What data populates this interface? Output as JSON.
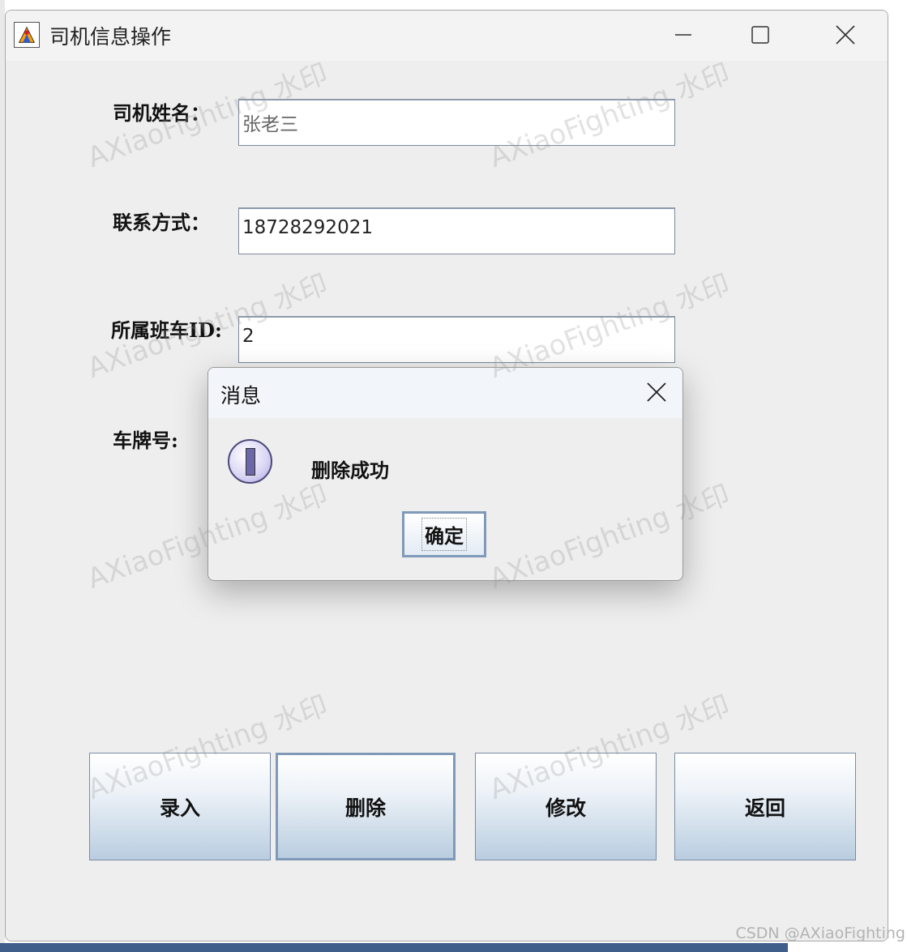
{
  "window": {
    "title": "司机信息操作"
  },
  "form": {
    "driver_name_label": "司机姓名：",
    "driver_name_value": "张老三",
    "contact_label": "联系方式：",
    "contact_value": "18728292021",
    "bus_id_label": "所属班车ID:",
    "bus_id_value": "2",
    "plate_label": "车牌号:"
  },
  "buttons": {
    "enter": "录入",
    "delete": "删除",
    "modify": "修改",
    "back": "返回"
  },
  "dialog": {
    "title": "消息",
    "message": "删除成功",
    "ok_label": "确定",
    "icon": "info-icon"
  },
  "watermark": {
    "text": "AXiaoFighting 水印",
    "corner_text": "CSDN @AXiaoFighting"
  },
  "colors": {
    "button_gradient_bottom": "#b9cde0",
    "focus_border": "#7f99b9",
    "taskbar": "#3f5f8a"
  }
}
